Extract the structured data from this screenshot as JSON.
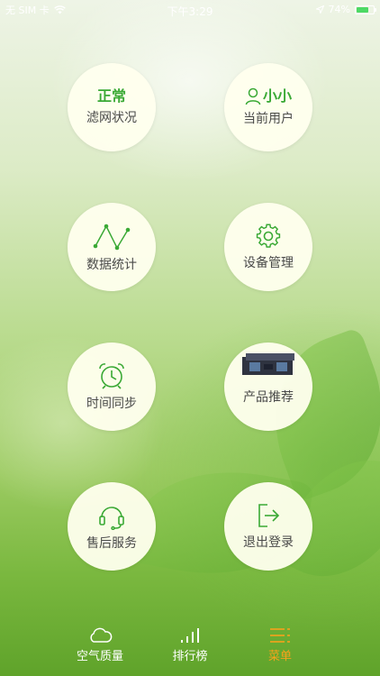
{
  "status": {
    "carrier": "无 SIM 卡",
    "time": "下午3:29",
    "battery": "74%",
    "battery_level": 0.74
  },
  "menu": {
    "filter": {
      "value": "正常",
      "label": "滤网状况",
      "icon": "filter-status"
    },
    "user": {
      "value": "小小",
      "label": "当前用户",
      "icon": "user-icon"
    },
    "stats": {
      "label": "数据统计",
      "icon": "line-chart-icon"
    },
    "device": {
      "label": "设备管理",
      "icon": "gear-icon"
    },
    "timesync": {
      "label": "时间同步",
      "icon": "alarm-clock-icon"
    },
    "products": {
      "label": "产品推荐",
      "icon": "product-image"
    },
    "service": {
      "label": "售后服务",
      "icon": "headset-icon"
    },
    "logout": {
      "label": "退出登录",
      "icon": "logout-icon"
    }
  },
  "tabs": [
    {
      "label": "空气质量",
      "icon": "cloud-icon",
      "active": false
    },
    {
      "label": "排行榜",
      "icon": "signal-bars-icon",
      "active": false
    },
    {
      "label": "菜单",
      "icon": "menu-icon",
      "active": true
    }
  ],
  "colors": {
    "accent_green": "#3aa935",
    "active_tab": "#f7a21b",
    "circle_bg": "#fffff0"
  }
}
